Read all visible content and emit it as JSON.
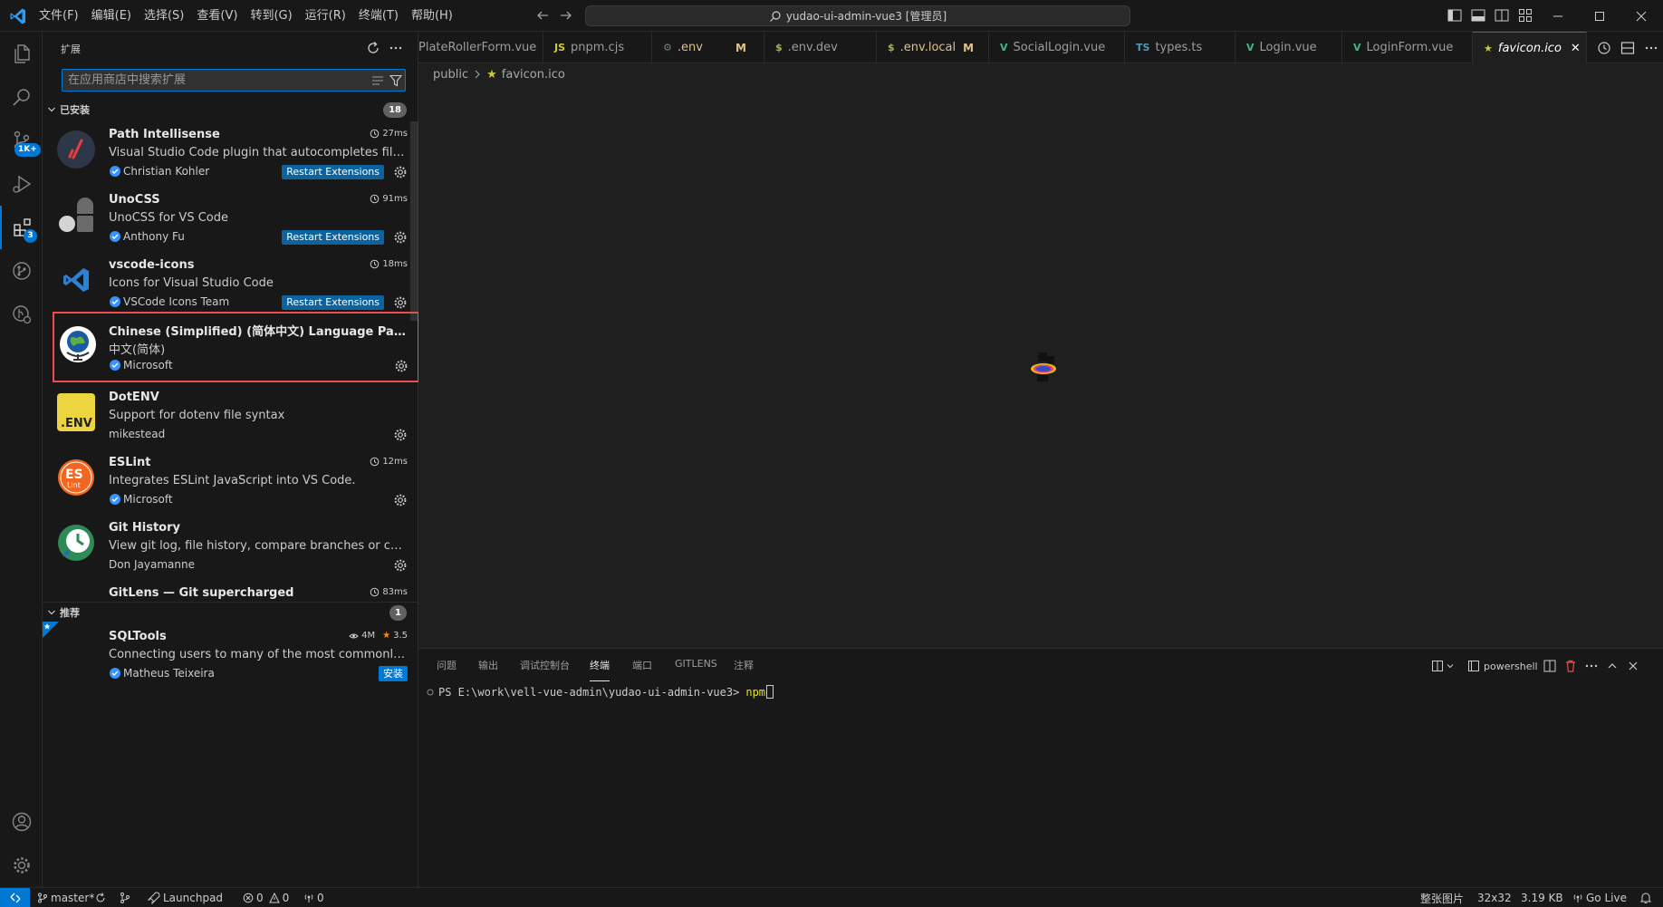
{
  "titlebar": {
    "menus": [
      "文件(F)",
      "编辑(E)",
      "选择(S)",
      "查看(V)",
      "转到(G)",
      "运行(R)",
      "终端(T)",
      "帮助(H)"
    ],
    "command_center": "yudao-ui-admin-vue3 [管理员]"
  },
  "activity": {
    "source_control_badge": "1K+",
    "extensions_badge": "3"
  },
  "sidebar": {
    "title": "扩展",
    "search_placeholder": "在应用商店中搜索扩展",
    "installed": {
      "label": "已安装",
      "count": "18",
      "items": [
        {
          "name": "Path Intellisense",
          "desc": "Visual Studio Code plugin that autocompletes filenames",
          "publisher": "Christian Kohler",
          "time": "27ms",
          "restart": "Restart Extensions"
        },
        {
          "name": "UnoCSS",
          "desc": "UnoCSS for VS Code",
          "publisher": "Anthony Fu",
          "time": "91ms",
          "restart": "Restart Extensions"
        },
        {
          "name": "vscode-icons",
          "desc": "Icons for Visual Studio Code",
          "publisher": "VSCode Icons Team",
          "time": "18ms",
          "restart": "Restart Extensions"
        },
        {
          "name": "Chinese (Simplified) (简体中文) Language Pack for Visual Studio Code",
          "desc": "中文(简体)",
          "publisher": "Microsoft"
        },
        {
          "name": "DotENV",
          "desc": "Support for dotenv file syntax",
          "publisher": "mikestead"
        },
        {
          "name": "ESLint",
          "desc": "Integrates ESLint JavaScript into VS Code.",
          "publisher": "Microsoft",
          "time": "12ms"
        },
        {
          "name": "Git History",
          "desc": "View git log, file history, compare branches or commits",
          "publisher": "Don Jayamanne"
        },
        {
          "name": "GitLens — Git supercharged",
          "time": "83ms"
        }
      ]
    },
    "recommended": {
      "label": "推荐",
      "count": "1",
      "items": [
        {
          "name": "SQLTools",
          "desc": "Connecting users to many of the most commonly used databases",
          "publisher": "Matheus Teixeira",
          "downloads": "4M",
          "rating": "3.5",
          "install": "安装"
        }
      ]
    }
  },
  "tabs": [
    {
      "icon": "",
      "label": "PlateRollerForm.vue"
    },
    {
      "icon": "JS",
      "label": "pnpm.cjs"
    },
    {
      "icon": "⚙",
      "label": ".env",
      "mod": "M"
    },
    {
      "icon": "$",
      "label": ".env.dev"
    },
    {
      "icon": "$",
      "label": ".env.local",
      "mod": "M"
    },
    {
      "icon": "V",
      "label": "SocialLogin.vue"
    },
    {
      "icon": "TS",
      "label": "types.ts"
    },
    {
      "icon": "V",
      "label": "Login.vue"
    },
    {
      "icon": "V",
      "label": "LoginForm.vue"
    },
    {
      "icon": "★",
      "label": "favicon.ico"
    }
  ],
  "breadcrumb": {
    "folder": "public",
    "file": "favicon.ico"
  },
  "panel": {
    "tabs": [
      "问题",
      "输出",
      "调试控制台",
      "终端",
      "端口",
      "GITLENS",
      "注释"
    ],
    "shell": "powershell",
    "prompt": "PS E:\\work\\vell-vue-admin\\yudao-ui-admin-vue3>",
    "command": "npm"
  },
  "statusbar": {
    "branch": "master*",
    "launchpad": "Launchpad",
    "errors": "0",
    "warnings": "0",
    "ports": "0",
    "image_label": "整张图片",
    "image_size": "32x32",
    "file_size": "3.19 KB",
    "golive": "Go Live"
  },
  "colors": {
    "accent": "#0078d4",
    "highlight_border": "#f14c4c",
    "modified": "#e2c08d"
  }
}
